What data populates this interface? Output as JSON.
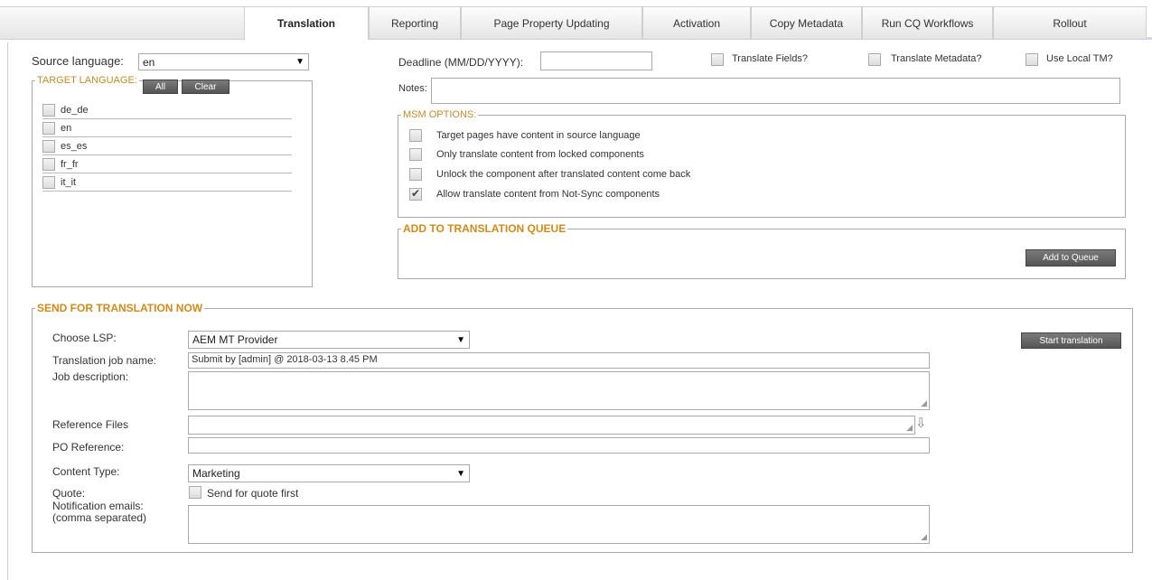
{
  "tabs": [
    "Translation",
    "Reporting",
    "Page Property Updating",
    "Activation",
    "Copy Metadata",
    "Run CQ Workflows",
    "Rollout"
  ],
  "source": {
    "label": "Source language:",
    "value": "en"
  },
  "target": {
    "legend": "TARGET LANGUAGE:",
    "all_label": "All",
    "clear_label": "Clear",
    "languages": [
      "de_de",
      "en",
      "es_es",
      "fr_fr",
      "it_it"
    ]
  },
  "deadline": {
    "label": "Deadline (MM/DD/YYYY):",
    "value": ""
  },
  "options": {
    "translate_fields": "Translate Fields?",
    "translate_metadata": "Translate Metadata?",
    "use_local_tm": "Use Local TM?"
  },
  "notes": {
    "label": "Notes:",
    "value": ""
  },
  "msm": {
    "legend": "MSM OPTIONS:",
    "items": [
      {
        "label": "Target pages have content in source language",
        "checked": false
      },
      {
        "label": "Only translate content from locked components",
        "checked": false
      },
      {
        "label": "Unlock the component after translated content come back",
        "checked": false
      },
      {
        "label": "Allow translate content from Not-Sync components",
        "checked": true
      }
    ]
  },
  "queue": {
    "legend": "ADD TO TRANSLATION QUEUE",
    "button": "Add to Queue"
  },
  "send": {
    "legend": "SEND FOR TRANSLATION NOW",
    "start_button": "Start translation",
    "lsp_label": "Choose LSP:",
    "lsp_value": "AEM MT Provider",
    "job_name_label": "Translation job name:",
    "job_name_value": "Submit by [admin] @ 2018-03-13 8.45 PM",
    "job_desc_label": "Job description:",
    "ref_files_label": "Reference Files",
    "po_label": "PO Reference:",
    "content_type_label": "Content Type:",
    "content_type_value": "Marketing",
    "quote_label": "Quote:",
    "quote_option": "Send for quote first",
    "notif_label_1": "Notification emails:",
    "notif_label_2": "(comma separated)"
  }
}
